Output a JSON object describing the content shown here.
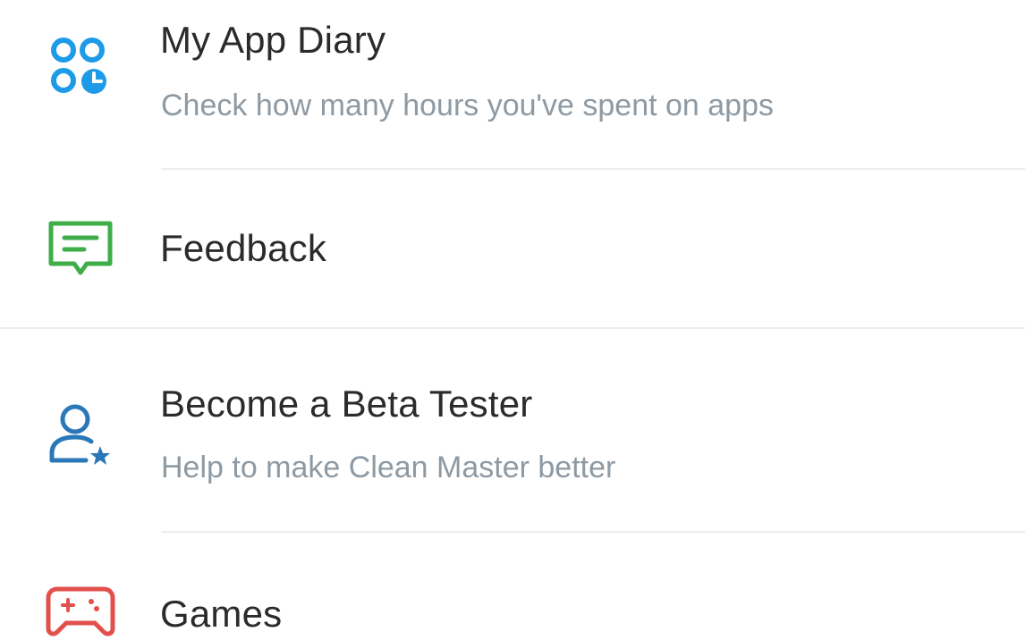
{
  "menu": {
    "items": [
      {
        "title": "My App Diary",
        "subtitle": "Check how many hours you've spent on apps",
        "icon": "app-diary-icon",
        "color": "#1e9be8"
      },
      {
        "title": "Feedback",
        "icon": "feedback-icon",
        "color": "#3fae49"
      },
      {
        "title": "Become a Beta Tester",
        "subtitle": "Help to make Clean Master better",
        "icon": "beta-tester-icon",
        "color": "#2a78b8"
      },
      {
        "title": "Games",
        "icon": "gamepad-icon",
        "color": "#e2504c"
      }
    ]
  }
}
